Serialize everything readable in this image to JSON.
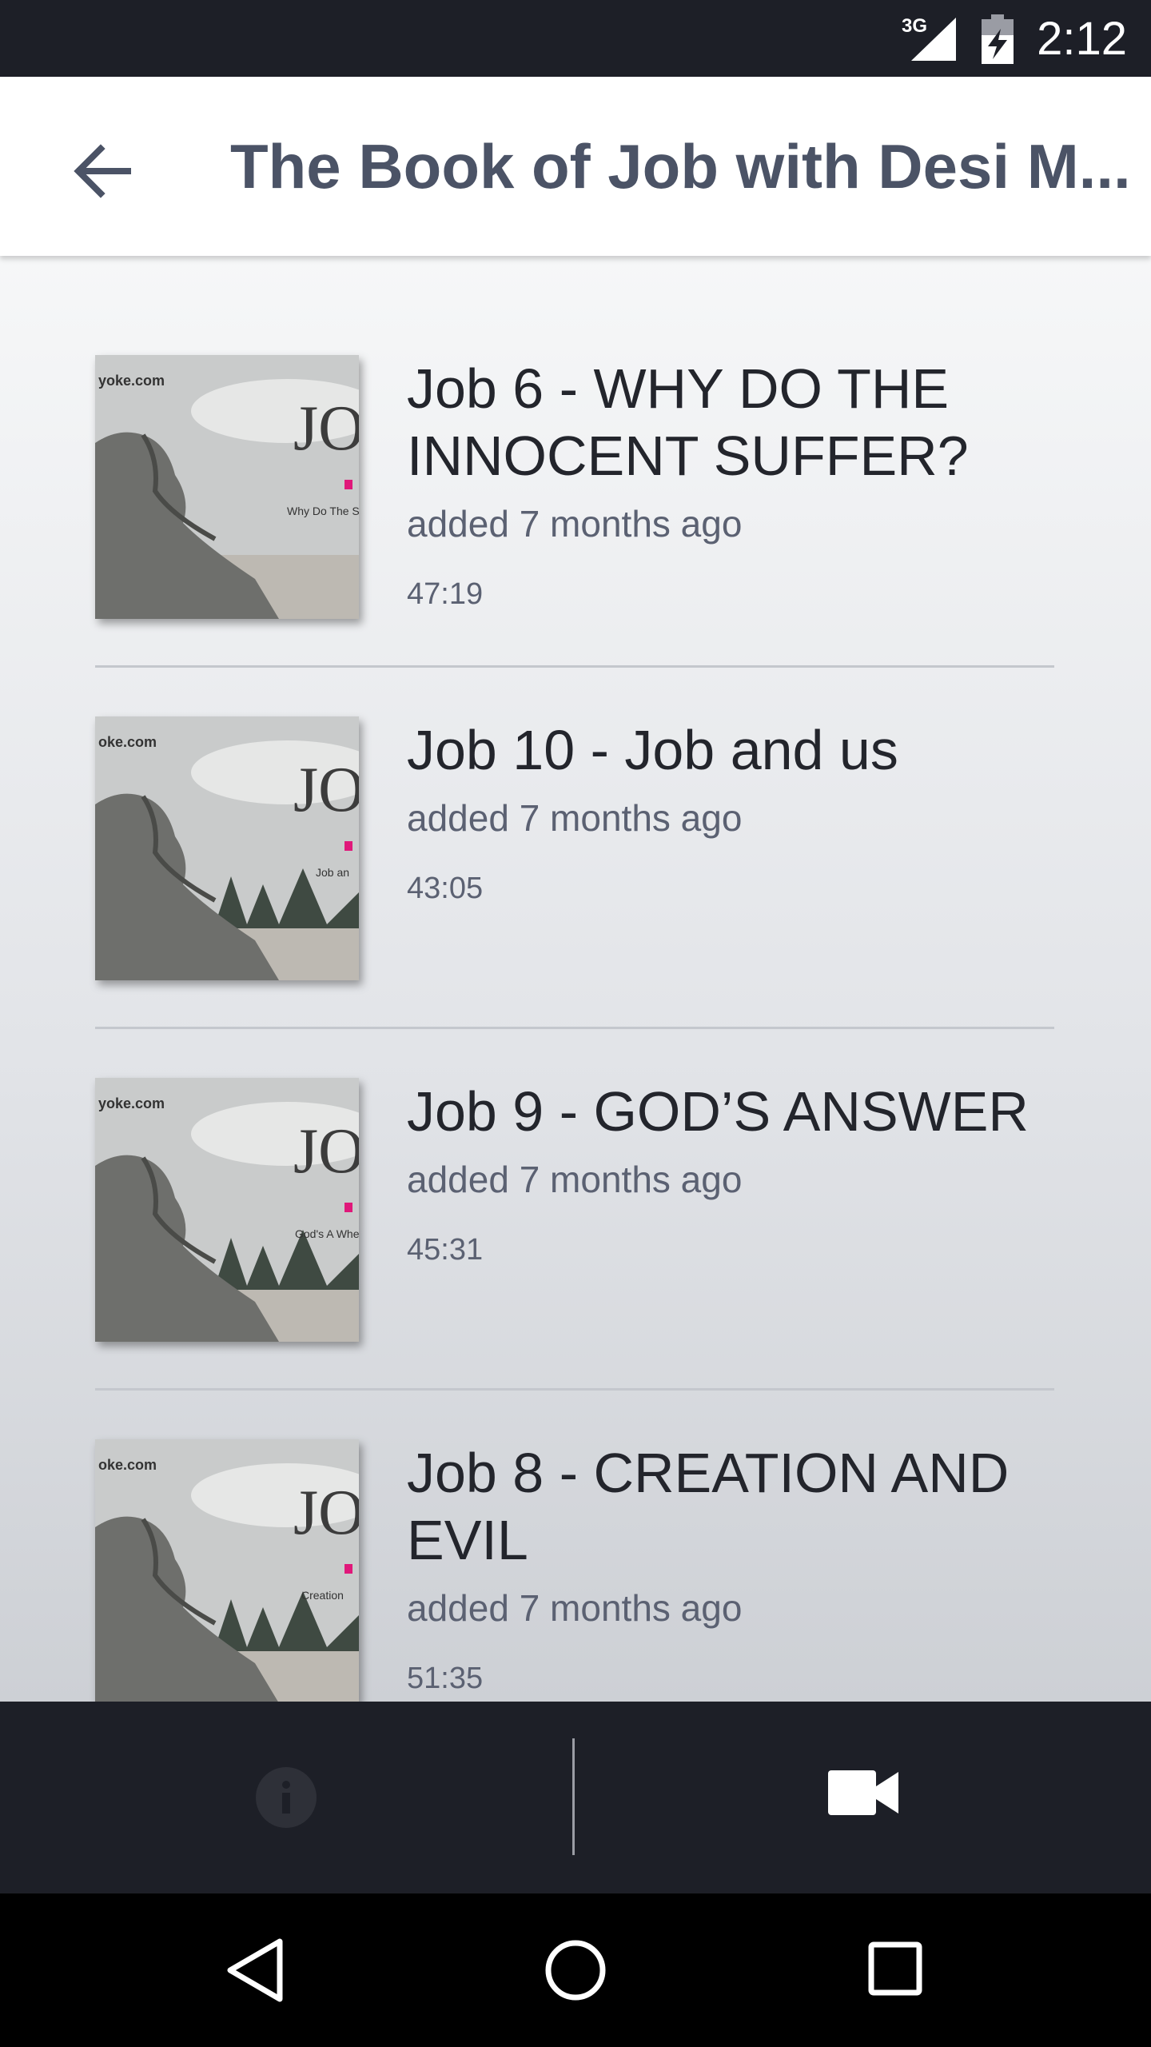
{
  "status_bar": {
    "time": "2:12",
    "network": "3G",
    "signal_icon": "cell-signal-icon",
    "battery_icon": "battery-charging-icon"
  },
  "app_bar": {
    "title": "The Book of Job with Desi M...",
    "back_icon": "arrow-back-icon"
  },
  "episodes": [
    {
      "title": "Job 6 - WHY DO THE INNOCENT SUFFER?",
      "added": "added 7 months ago",
      "duration": "47:19",
      "thumb_site": "yoke.com",
      "thumb_caption": "Why Do The Suffe"
    },
    {
      "title": "Job 10 - Job and us",
      "added": "added 7 months ago",
      "duration": "43:05",
      "thumb_site": "oke.com",
      "thumb_caption": "Job an"
    },
    {
      "title": "Job 9 - GOD’S ANSWER",
      "added": "added 7 months ago",
      "duration": "45:31",
      "thumb_site": "yoke.com",
      "thumb_caption": "God's A Where W"
    },
    {
      "title": "Job 8 - CREATION AND EVIL",
      "added": "added 7 months ago",
      "duration": "51:35",
      "thumb_site": "oke.com",
      "thumb_caption": "Creation"
    }
  ],
  "thumb_logo": "JO",
  "bottom_bar": {
    "info_icon": "info-icon",
    "video_icon": "video-camera-icon"
  },
  "nav_bar": {
    "back_icon": "nav-back-icon",
    "home_icon": "nav-home-icon",
    "recents_icon": "nav-recents-icon"
  },
  "colors": {
    "accent_dark": "#1d1f27",
    "title_text": "#4b5366",
    "pink_mark": "#e0187a"
  }
}
